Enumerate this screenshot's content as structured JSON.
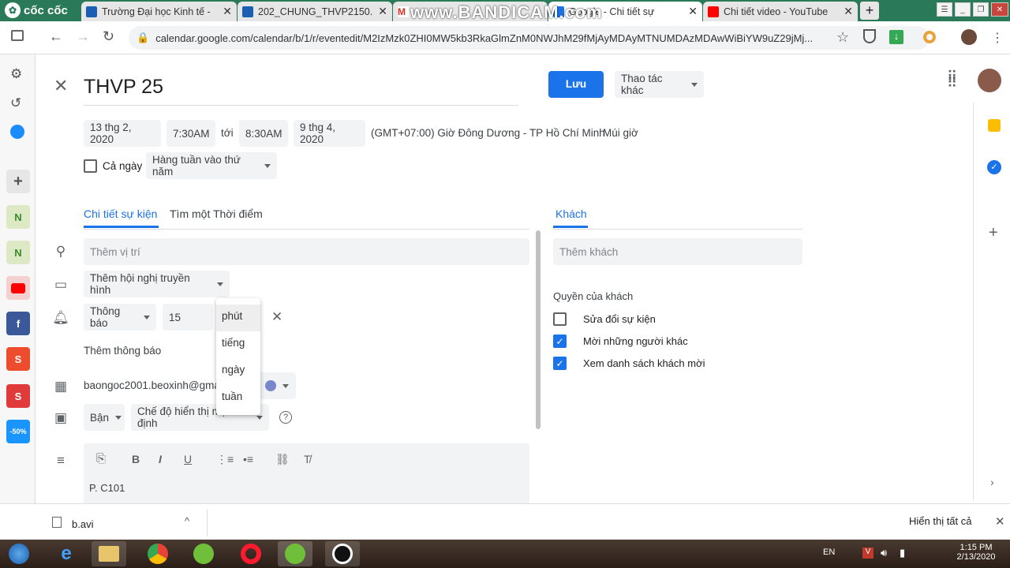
{
  "browser": {
    "logo_text": "cốc cốc",
    "tabs": [
      {
        "title": "Trường Đại học Kinh tế -",
        "favicon_color": "#1a5fb4"
      },
      {
        "title": "202_CHUNG_THVP2150.",
        "favicon_color": "#1a5fb4"
      },
      {
        "title": "Google - Chi tiết sự",
        "favicon_color": "#1a73e8"
      },
      {
        "title": "Chi tiết video - YouTube",
        "favicon_color": "#ff0000"
      }
    ],
    "overlay_text": "www.BANDICAM.com",
    "url": "calendar.google.com/calendar/b/1/r/eventedit/M2IzMzk0ZHI0MW5kb3RkaGlmZnM0NWJhM29fMjAyMDAyMTNUMDAzMDAwWiBiYW9uZ29jMj..."
  },
  "event": {
    "title": "THVP 25",
    "save_label": "Lưu",
    "more_actions_label": "Thao tác khác",
    "start_date": "13 thg 2, 2020",
    "start_time": "7:30AM",
    "to_label": "tới",
    "end_time": "8:30AM",
    "end_date": "9 thg 4, 2020",
    "timezone": "(GMT+07:00) Giờ Đông Dương - TP Hồ Chí Minh",
    "timezone_link": "Múi giờ",
    "all_day_label": "Cả ngày",
    "recurrence": "Hàng tuần vào thứ năm"
  },
  "details": {
    "tab_details": "Chi tiết sự kiện",
    "tab_find_time": "Tìm một Thời điểm",
    "location_placeholder": "Thêm vị trí",
    "conference": "Thêm hội nghị truyền hình",
    "notification_type": "Thông báo",
    "notification_value": "15",
    "add_notification": "Thêm thông báo",
    "calendar_owner": "baongoc2001.beoxinh@gma",
    "busy_label": "Bận",
    "visibility_label": "Chế độ hiển thị mặc định",
    "description": "P. C101"
  },
  "unit_menu": {
    "options": [
      "phút",
      "tiếng",
      "ngày",
      "tuần"
    ],
    "selected": "phút"
  },
  "guests": {
    "tab_label": "Khách",
    "add_placeholder": "Thêm khách",
    "permissions_heading": "Quyền của khách",
    "permissions": [
      {
        "label": "Sửa đổi sự kiện",
        "checked": false
      },
      {
        "label": "Mời những người khác",
        "checked": true
      },
      {
        "label": "Xem danh sách khách mời",
        "checked": true
      }
    ]
  },
  "downloads": {
    "file": "b.avi",
    "show_all": "Hiển thị tất cả"
  },
  "taskbar": {
    "lang": "EN",
    "time": "1:15 PM",
    "date": "2/13/2020"
  },
  "colors": {
    "accent": "#1a73e8",
    "calendar_dot": "#7986cb"
  }
}
